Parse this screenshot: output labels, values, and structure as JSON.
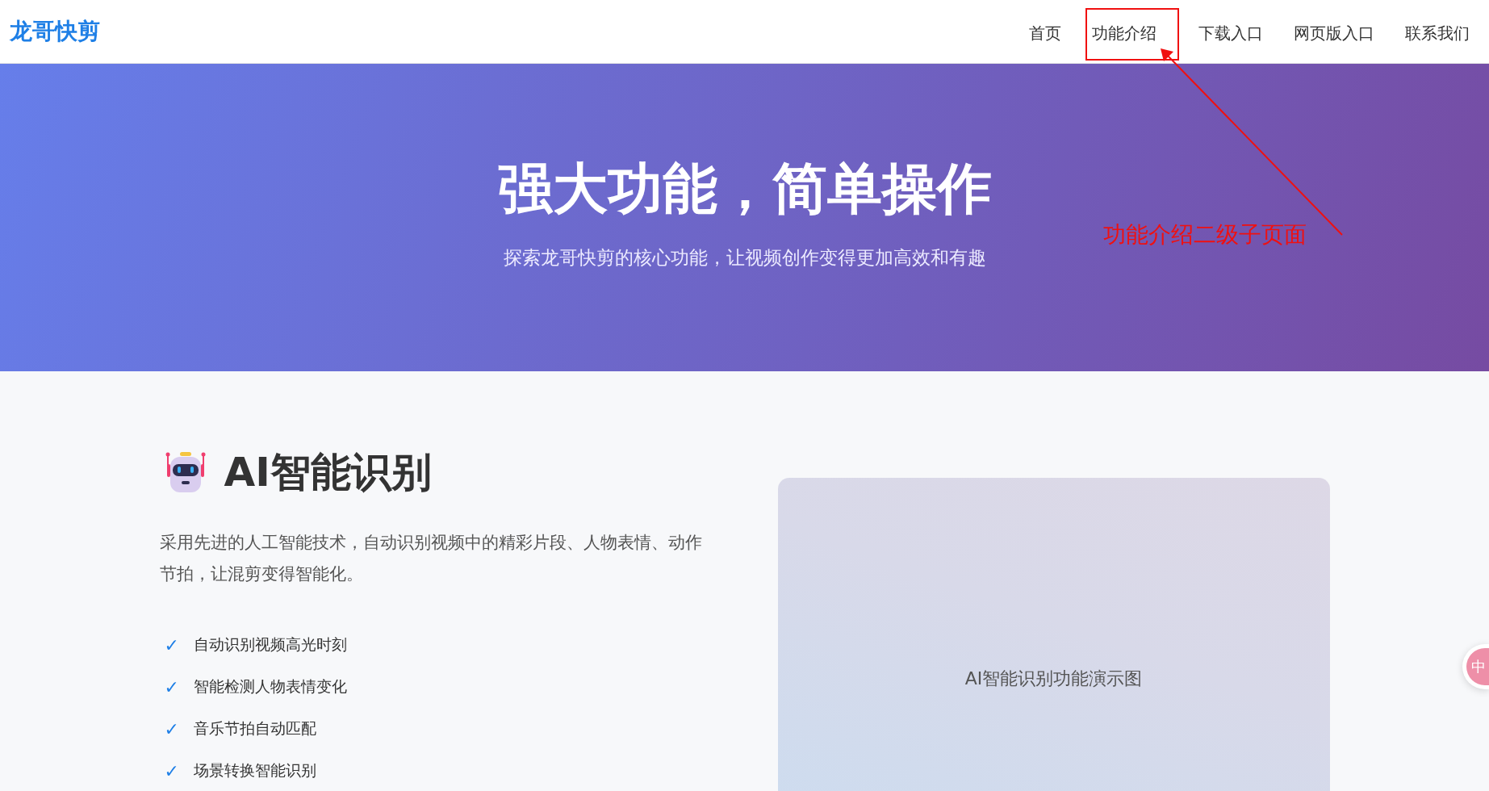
{
  "header": {
    "logo": "龙哥快剪",
    "nav": [
      {
        "label": "首页",
        "selected": false
      },
      {
        "label": "功能介绍",
        "selected": true
      },
      {
        "label": "下载入口",
        "selected": false
      },
      {
        "label": "网页版入口",
        "selected": false
      },
      {
        "label": "联系我们",
        "selected": false
      }
    ]
  },
  "hero": {
    "title": "强大功能，简单操作",
    "subtitle": "探索龙哥快剪的核心功能，让视频创作变得更加高效和有趣"
  },
  "annotation": {
    "text": "功能介绍二级子页面"
  },
  "feature": {
    "title": "AI智能识别",
    "description": "采用先进的人工智能技术，自动识别视频中的精彩片段、人物表情、动作节拍，让混剪变得智能化。",
    "points": [
      "自动识别视频高光时刻",
      "智能检测人物表情变化",
      "音乐节拍自动匹配",
      "场景转换智能识别"
    ],
    "check_mark": "✓",
    "image_caption": "AI智能识别功能演示图"
  },
  "floating_widget": {
    "label": "中"
  }
}
